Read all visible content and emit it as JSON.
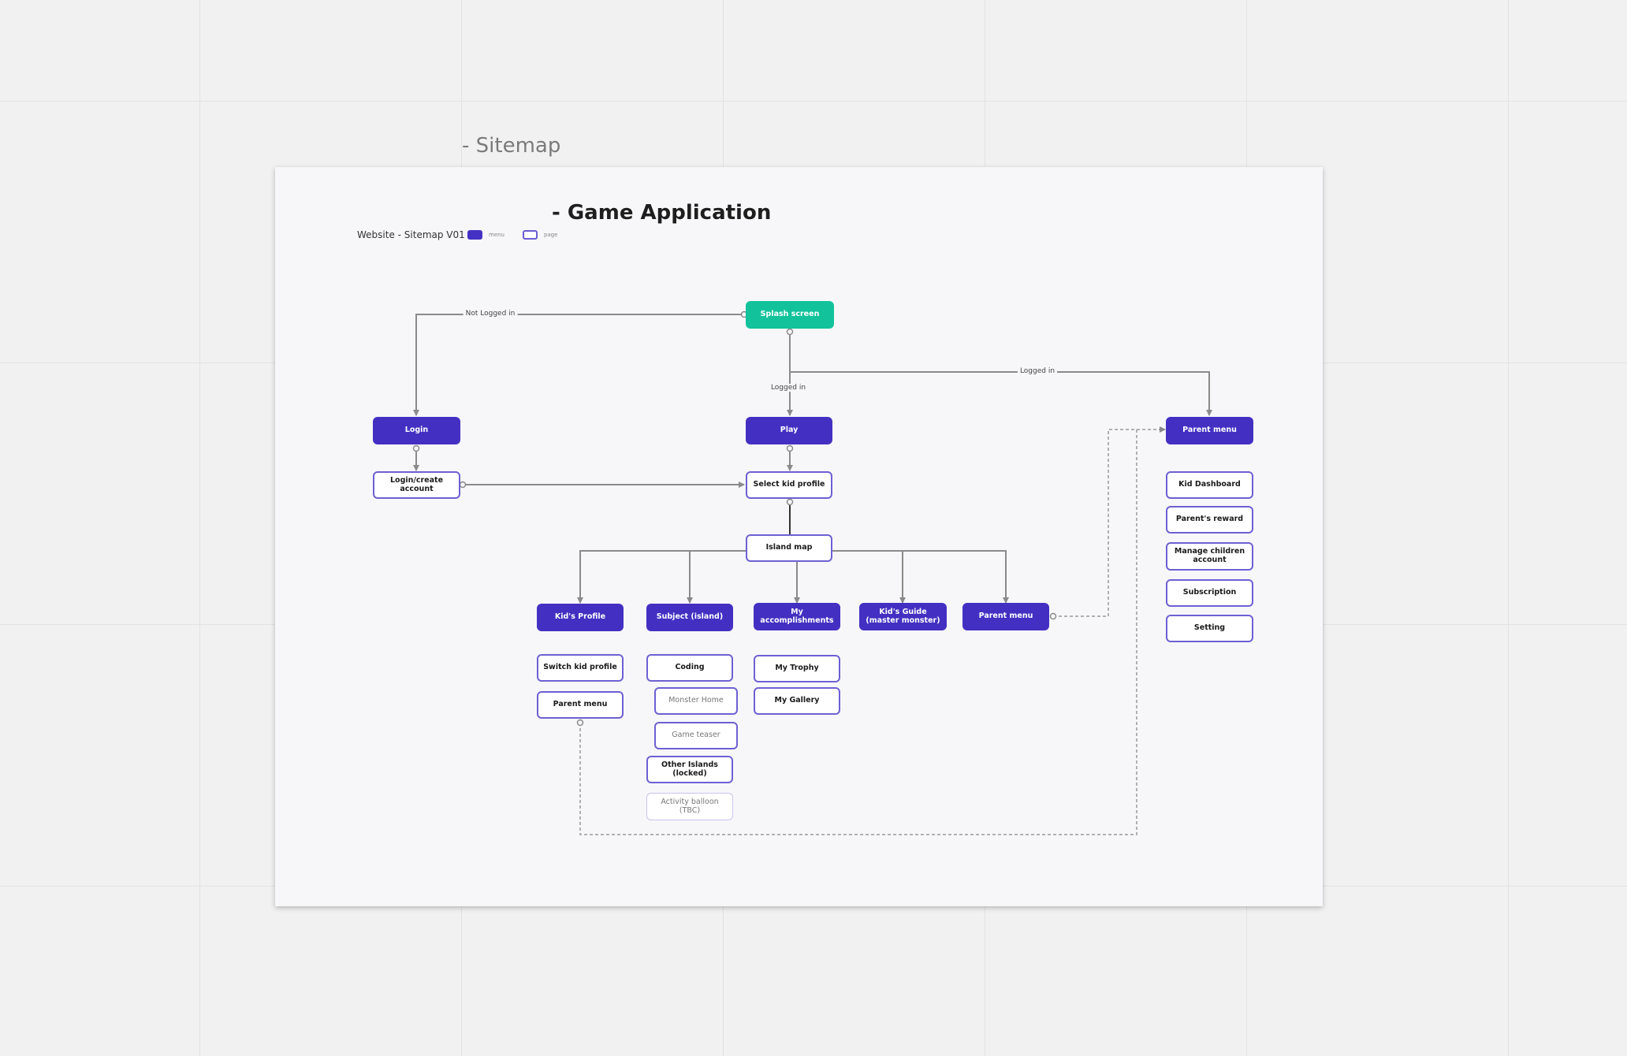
{
  "frame_title": "-  Sitemap",
  "board": {
    "title": "- Game Application",
    "legend": {
      "label": "Website - Sitemap V01",
      "menu_text": "menu",
      "page_text": "page"
    }
  },
  "edge_labels": {
    "not_logged_in": "Not Logged in",
    "logged_in_center": "Logged in",
    "logged_in_right": "Logged in"
  },
  "nodes": {
    "splash": "Splash screen",
    "login": "Login",
    "login_create": "Login/create account",
    "play": "Play",
    "select_kid": "Select kid profile",
    "island_map": "Island map",
    "parent_menu_top": "Parent menu",
    "kid_dashboard": "Kid Dashboard",
    "parents_reward": "Parent's reward",
    "manage_children": "Manage children account",
    "subscription": "Subscription",
    "setting": "Setting",
    "kids_profile": "Kid's Profile",
    "subject_island": "Subject (island)",
    "my_accomplishments": "My accomplishments",
    "kids_guide": "Kid's Guide (master monster)",
    "parent_menu_mid": "Parent menu",
    "switch_kid": "Switch kid profile",
    "parent_menu_low": "Parent menu",
    "coding": "Coding",
    "monster_home": "Monster Home",
    "game_teaser": "Game teaser",
    "other_islands": "Other Islands (locked)",
    "activity_balloon": "Activity balloon (TBC)",
    "my_trophy": "My Trophy",
    "my_gallery": "My Gallery"
  },
  "colors": {
    "menu": "#4330c2",
    "page_border": "#6d60d3",
    "start": "#12c29b",
    "connector": "#8a8a8a",
    "dashed": "#b0b0b0"
  }
}
